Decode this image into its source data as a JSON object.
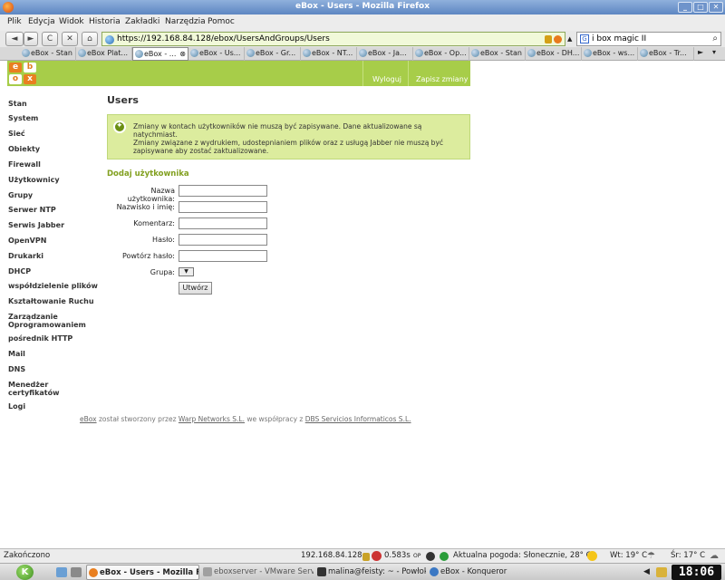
{
  "window": {
    "title": "eBox - Users - Mozilla Firefox"
  },
  "menubar": [
    "Plik",
    "Edycja",
    "Widok",
    "Historia",
    "Zakładki",
    "Narzędzia",
    "Pomoc"
  ],
  "nav": {
    "back": "◄",
    "forward": "►",
    "reload": "C",
    "stop": "✕",
    "home": "⌂",
    "url": "https://192.168.84.128/ebox/UsersAndGroups/Users",
    "search_value": "i box magic II"
  },
  "tabs": [
    "eBox - Stan",
    "eBox Plat...",
    "eBox - ...",
    "eBox - Us...",
    "eBox - Gr...",
    "eBox - NT...",
    "eBox - Ja...",
    "eBox - Op...",
    "eBox - Stan",
    "eBox - DH...",
    "eBox - ws...",
    "eBox - Tr..."
  ],
  "header": {
    "logout": "Wyloguj",
    "save_changes": "Zapisz zmiany"
  },
  "sidebar": [
    "Stan",
    "System",
    "Sieć",
    "Obiekty",
    "Firewall",
    "Użytkownicy",
    "Grupy",
    "Serwer NTP",
    "Serwis Jabber",
    "OpenVPN",
    "Drukarki",
    "DHCP",
    "współdzielenie plików",
    "Kształtowanie Ruchu",
    "Zarządzanie Oprogramowaniem",
    "pośrednik HTTP",
    "Mail",
    "DNS",
    "Menedżer certyfikatów",
    "Logi"
  ],
  "page": {
    "title": "Users",
    "note1": "Zmiany w kontach użytkowników nie muszą być zapisywane. Dane aktualizowane są natychmiast.",
    "note2": "Zmiany związane z wydrukiem, udostepnianiem plików oraz z usługą Jabber nie muszą być zapisywane aby zostać zaktualizowane.",
    "section": "Dodaj użytkownika",
    "form": {
      "login_label": "Nazwa użytkownika:",
      "fullname_label": "Nazwisko i imię:",
      "comment_label": "Komentarz:",
      "password_label": "Hasło:",
      "password2_label": "Powtórz hasło:",
      "group_label": "Grupa:",
      "submit": "Utwórz"
    },
    "footer": {
      "ebox": "eBox",
      "t1": " został stworzony przez ",
      "warp": "Warp Networks S.L.",
      "t2": " we współpracy z ",
      "dbs": "DBS Servicios Informaticos S.L."
    }
  },
  "statusbar": {
    "left": "Zakończono",
    "ip": "192.168.84.128",
    "time": "0.583s",
    "op": "OP",
    "weather": "Aktualna pogoda: Słonecznie, 28° C",
    "wt": "Wt: 19° C",
    "sr": "Śr: 17° C"
  },
  "taskbar": {
    "tasks": [
      "eBox - Users - Mozilla Fir",
      "eboxserver - VMware Serve",
      "malina@feisty: ~ - Powłoka",
      "eBox - Konqueror"
    ],
    "clock": "18:06"
  },
  "colors": {
    "ebox_green": "#a7cd49",
    "note_bg": "#dcec9e",
    "section_green": "#82a020",
    "logo_orange": "#e97f20"
  }
}
